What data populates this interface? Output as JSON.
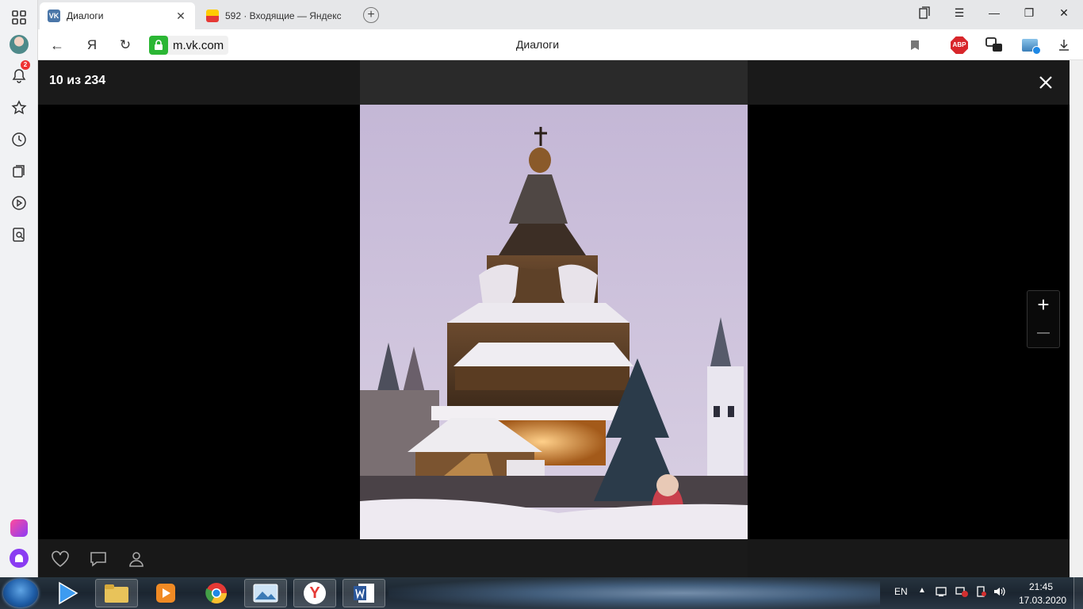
{
  "browser": {
    "tabs": [
      {
        "label": "Диалоги",
        "favicon": "vk-icon",
        "active": true
      },
      {
        "label": "592 · Входящие — Яндекс",
        "favicon": "yandex-mail-icon",
        "active": false
      }
    ],
    "address": {
      "url": "m.vk.com",
      "page_title": "Диалоги"
    },
    "notifications_badge": "2",
    "extension_abp_label": "ABP"
  },
  "viewer": {
    "counter": "10 из 234",
    "zoom_in_label": "+",
    "zoom_out_label": "—"
  },
  "taskbar": {
    "language": "EN",
    "time": "21:45",
    "date": "17.03.2020"
  },
  "colors": {
    "vk_blue": "#4a76a8",
    "lock_green": "#2bb634",
    "abp_red": "#d8262b",
    "viewer_bg": "#000000"
  }
}
